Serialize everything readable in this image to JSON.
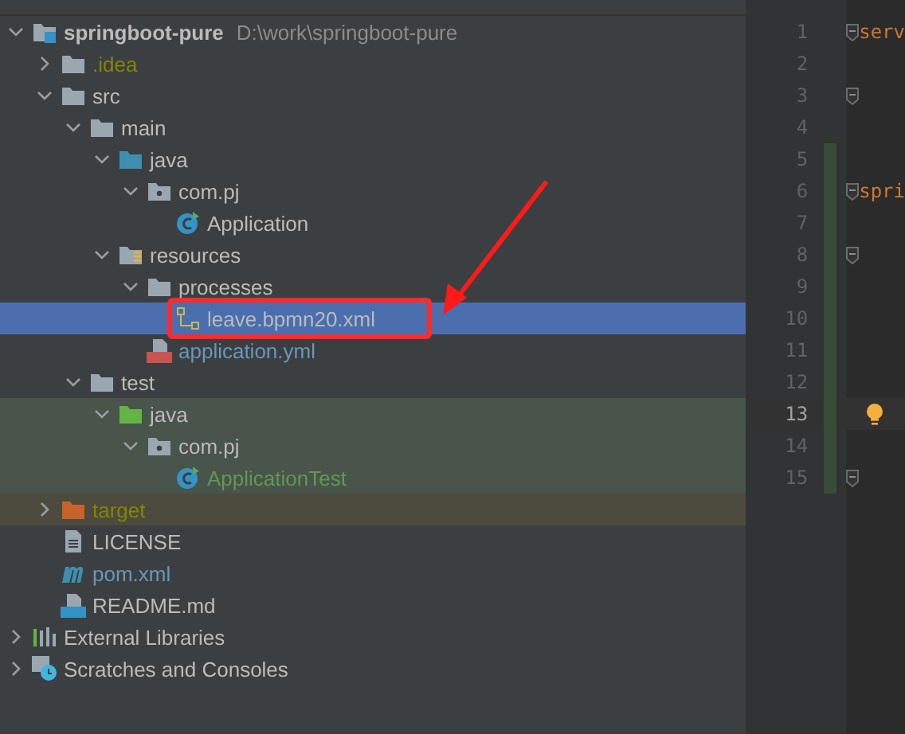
{
  "project_tree": [
    {
      "label": "springboot-pure",
      "kind": "module",
      "path": "D:\\work\\springboot-pure",
      "expanded": true,
      "selected": false,
      "children": [
        {
          "label": ".idea",
          "kind": "folder",
          "ignored": true,
          "expanded": false,
          "selected": false
        },
        {
          "label": "src",
          "kind": "folder",
          "expanded": true,
          "selected": false,
          "children": [
            {
              "label": "main",
              "kind": "folder",
              "expanded": true,
              "selected": false,
              "children": [
                {
                  "label": "java",
                  "kind": "source-folder",
                  "expanded": true,
                  "selected": false,
                  "children": [
                    {
                      "label": "com.pj",
                      "kind": "package",
                      "expanded": true,
                      "selected": false,
                      "children": [
                        {
                          "label": "Application",
                          "kind": "class",
                          "selected": false
                        }
                      ]
                    }
                  ]
                },
                {
                  "label": "resources",
                  "kind": "resources-folder",
                  "expanded": true,
                  "selected": false,
                  "children": [
                    {
                      "label": "processes",
                      "kind": "folder",
                      "expanded": true,
                      "selected": false,
                      "children": [
                        {
                          "label": "leave.bpmn20.xml",
                          "kind": "bpmn",
                          "selected": true
                        }
                      ]
                    },
                    {
                      "label": "application.yml",
                      "kind": "yml",
                      "modified": true,
                      "selected": false
                    }
                  ]
                }
              ]
            },
            {
              "label": "test",
              "kind": "folder",
              "expanded": true,
              "selected": false,
              "children": [
                {
                  "label": "java",
                  "kind": "test-folder",
                  "test_scope": true,
                  "expanded": true,
                  "selected": false,
                  "children": [
                    {
                      "label": "com.pj",
                      "kind": "package",
                      "test_scope": true,
                      "expanded": true,
                      "selected": false,
                      "children": [
                        {
                          "label": "ApplicationTest",
                          "kind": "class",
                          "test_scope": true,
                          "added": true,
                          "selected": false
                        }
                      ]
                    }
                  ]
                }
              ]
            }
          ]
        },
        {
          "label": "target",
          "kind": "excluded-folder",
          "excluded": true,
          "ignored": true,
          "expanded": false,
          "selected": false
        },
        {
          "label": "LICENSE",
          "kind": "text",
          "selected": false
        },
        {
          "label": "pom.xml",
          "kind": "maven",
          "modified": true,
          "selected": false
        },
        {
          "label": "README.md",
          "kind": "markdown",
          "selected": false
        }
      ]
    },
    {
      "label": "External Libraries",
      "kind": "libraries",
      "expanded": false,
      "selected": false
    },
    {
      "label": "Scratches and Consoles",
      "kind": "scratches",
      "expanded": false,
      "selected": false
    }
  ],
  "editor": {
    "lines": [
      {
        "number": "1",
        "code": "serv",
        "fold": true,
        "current": false,
        "changed": false
      },
      {
        "number": "2",
        "current": false,
        "changed": false
      },
      {
        "number": "3",
        "fold": true,
        "current": false,
        "changed": false
      },
      {
        "number": "4",
        "current": false,
        "changed": false
      },
      {
        "number": "5",
        "current": false,
        "changed": true
      },
      {
        "number": "6",
        "code": "spri",
        "fold": true,
        "current": false,
        "changed": true
      },
      {
        "number": "7",
        "current": false,
        "changed": true
      },
      {
        "number": "8",
        "fold": true,
        "current": false,
        "changed": true
      },
      {
        "number": "9",
        "current": false,
        "changed": true
      },
      {
        "number": "10",
        "current": false,
        "changed": true
      },
      {
        "number": "11",
        "current": false,
        "changed": true
      },
      {
        "number": "12",
        "current": false,
        "changed": true
      },
      {
        "number": "13",
        "current": true,
        "bulb": true,
        "changed": true
      },
      {
        "number": "14",
        "current": false,
        "changed": true
      },
      {
        "number": "15",
        "fold": true,
        "current": false,
        "changed": true
      }
    ]
  }
}
